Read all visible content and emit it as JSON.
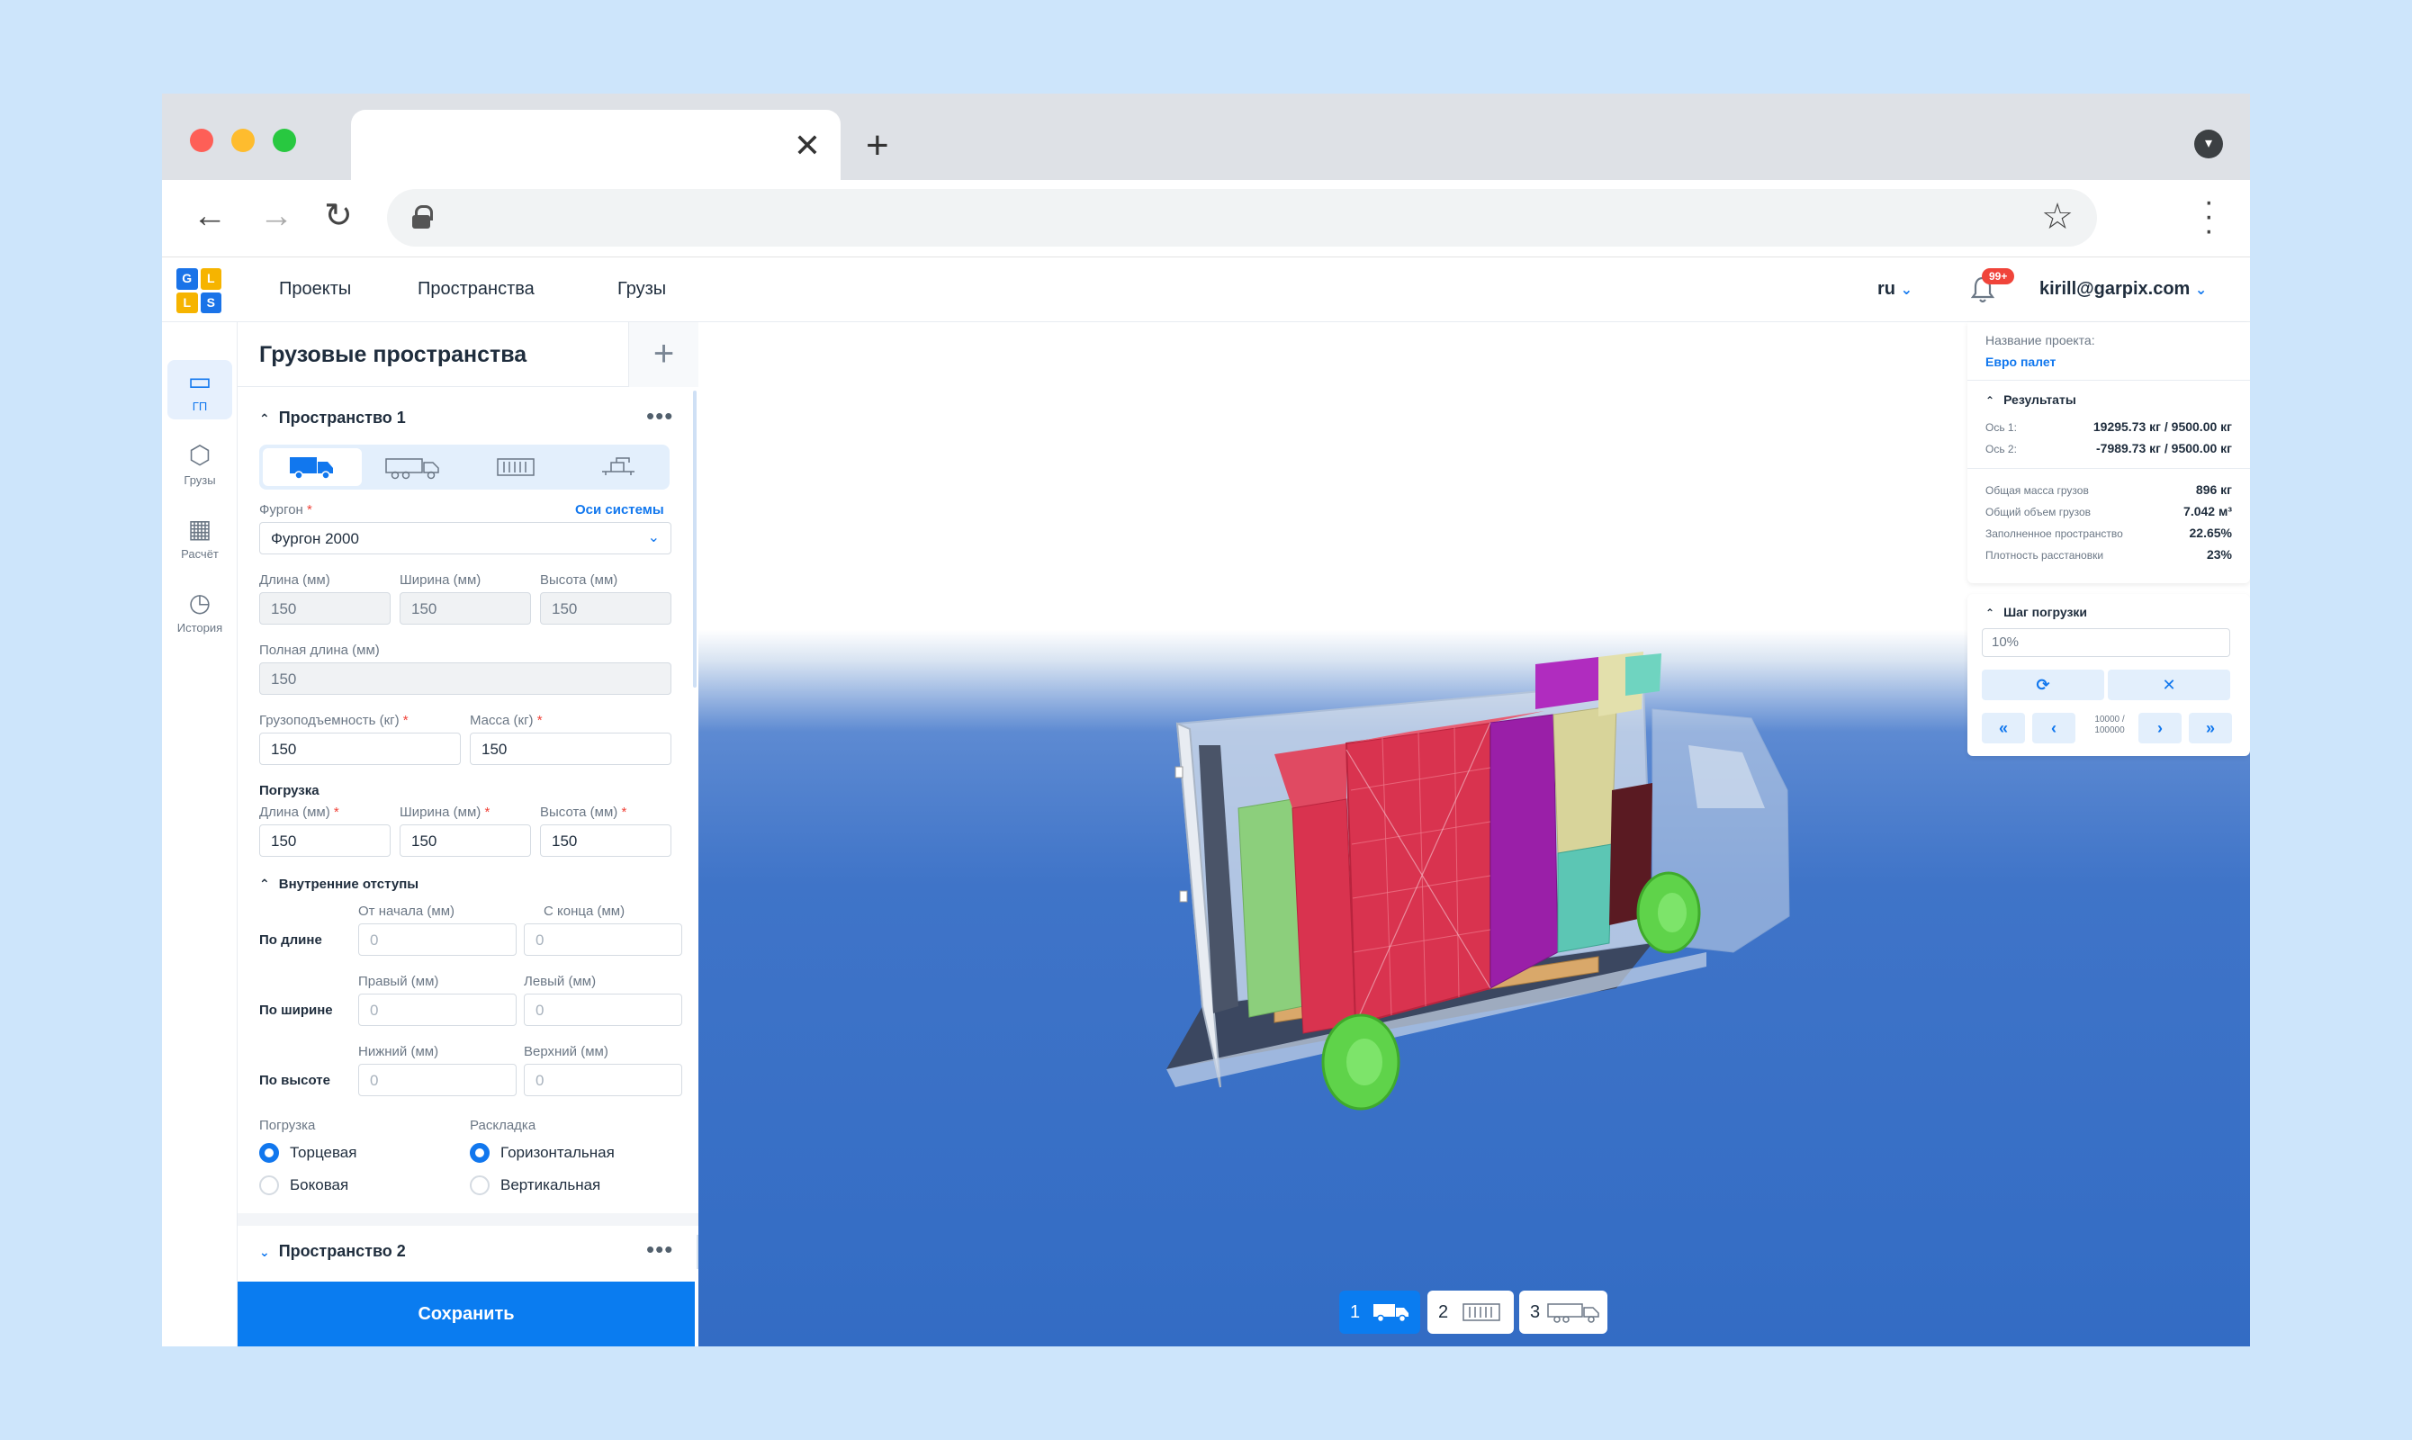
{
  "browser": {
    "tab_close": "✕",
    "new_tab": "+"
  },
  "app": {
    "nav": [
      "Проекты",
      "Пространства",
      "Грузы"
    ],
    "lang": "ru",
    "notifications_badge": "99+",
    "user": "kirill@garpix.com",
    "logo_letters": [
      "G",
      "L",
      "L",
      "S"
    ]
  },
  "rail": {
    "items": [
      {
        "label": "ГП",
        "icon": "cargo-space-icon",
        "active": true
      },
      {
        "label": "Грузы",
        "icon": "box-icon",
        "active": false
      },
      {
        "label": "Расчёт",
        "icon": "calc-grid-icon",
        "active": false
      },
      {
        "label": "История",
        "icon": "clock-icon",
        "active": false
      }
    ]
  },
  "panel": {
    "title": "Грузовые пространства",
    "space1": {
      "title": "Пространство 1",
      "vehicle_label": "Фургон",
      "axes_link": "Оси системы",
      "vehicle_value": "Фургон 2000",
      "length_label": "Длина (мм)",
      "length_value": "150",
      "width_label": "Ширина (мм)",
      "width_value": "150",
      "height_label": "Высота (мм)",
      "height_value": "150",
      "full_length_label": "Полная длина (мм)",
      "full_length_value": "150",
      "capacity_label": "Грузоподъемность (кг)",
      "capacity_value": "150",
      "mass_label": "Масса (кг)",
      "mass_value": "150",
      "loading_title": "Погрузка",
      "load_length_label": "Длина (мм)",
      "load_length_value": "150",
      "load_width_label": "Ширина (мм)",
      "load_width_value": "150",
      "load_height_label": "Высота (мм)",
      "load_height_value": "150",
      "padding_title": "Внутренние отступы",
      "by_length": "По длине",
      "from_start": "От начала (мм)",
      "from_end": "С конца (мм)",
      "by_width": "По ширине",
      "right": "Правый (мм)",
      "left": "Левый (мм)",
      "by_height": "По высоте",
      "bottom": "Нижний (мм)",
      "top": "Верхний (мм)",
      "padding_placeholder": "0",
      "loading_type_label": "Погрузка",
      "loading_opt1": "Торцевая",
      "loading_opt2": "Боковая",
      "layout_label": "Раскладка",
      "layout_opt1": "Горизонтальная",
      "layout_opt2": "Вертикальная"
    },
    "space2": {
      "title": "Пространство 2"
    },
    "save": "Сохранить"
  },
  "info": {
    "project_label": "Название проекта:",
    "project_name": "Евро палет",
    "results_title": "Результаты",
    "axis1_label": "Ось 1:",
    "axis1_value": "19295.73 кг / 9500.00 кг",
    "axis2_label": "Ось 2:",
    "axis2_value": "-7989.73 кг / 9500.00 кг",
    "stats": [
      {
        "label": "Общая масса грузов",
        "value": "896 кг"
      },
      {
        "label": "Общий объем грузов",
        "value": "7.042 м³"
      },
      {
        "label": "Заполненное пространство",
        "value": "22.65%"
      },
      {
        "label": "Плотность расстановки",
        "value": "23%"
      }
    ]
  },
  "step": {
    "title": "Шаг погрузки",
    "value": "10%",
    "counter_top": "10000 /",
    "counter_bottom": "100000"
  },
  "spaces": [
    "1",
    "2",
    "3"
  ],
  "colors": {
    "accent": "#0a7cf0",
    "cargo_red": "#d9334f",
    "cargo_purple": "#9a1fa8",
    "cargo_teal": "#5cc6b4",
    "cargo_khaki": "#d8d49a",
    "cargo_green": "#8ccf7c",
    "wheel_green": "#5fd34a"
  }
}
